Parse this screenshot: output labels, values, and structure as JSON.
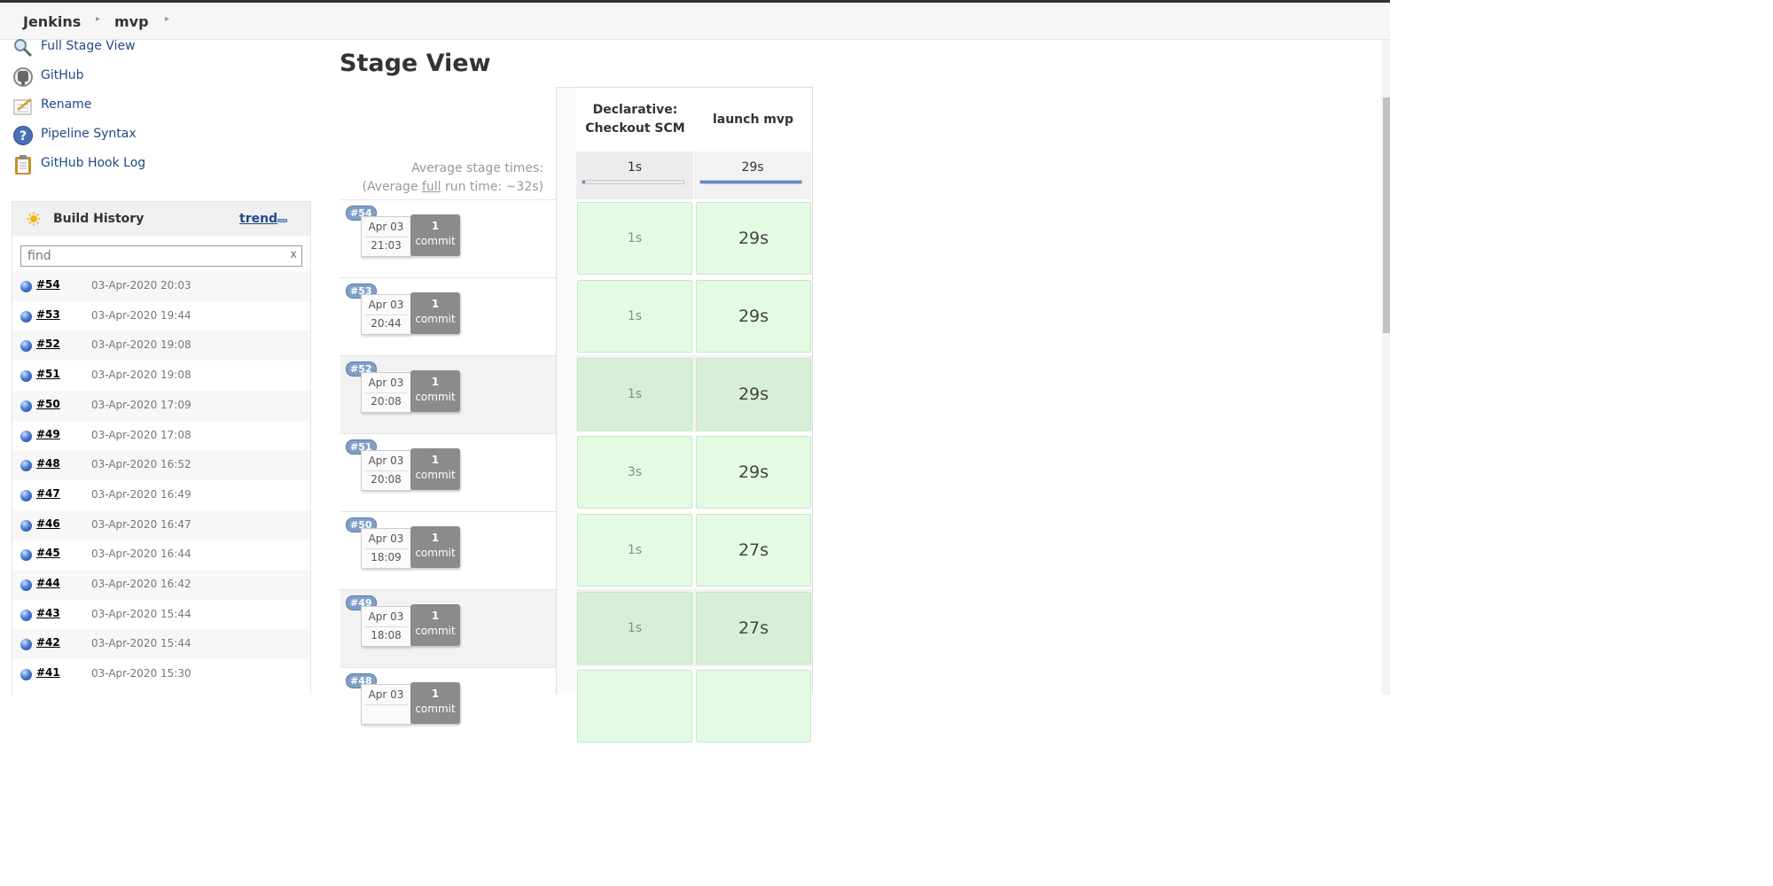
{
  "breadcrumb": {
    "items": [
      "Jenkins",
      "mvp"
    ]
  },
  "tasks": [
    {
      "label": "Full Stage View",
      "icon": "magnifier-icon"
    },
    {
      "label": "GitHub",
      "icon": "github-icon"
    },
    {
      "label": "Rename",
      "icon": "notepad-pencil-icon"
    },
    {
      "label": "Pipeline Syntax",
      "icon": "help-icon"
    },
    {
      "label": "GitHub Hook Log",
      "icon": "clipboard-icon"
    }
  ],
  "build_history": {
    "title": "Build History",
    "trend_label": "trend",
    "search_placeholder": "find",
    "clear_label": "x",
    "builds": [
      {
        "num": "#54",
        "date": "03-Apr-2020 20:03"
      },
      {
        "num": "#53",
        "date": "03-Apr-2020 19:44"
      },
      {
        "num": "#52",
        "date": "03-Apr-2020 19:08"
      },
      {
        "num": "#51",
        "date": "03-Apr-2020 19:08"
      },
      {
        "num": "#50",
        "date": "03-Apr-2020 17:09"
      },
      {
        "num": "#49",
        "date": "03-Apr-2020 17:08"
      },
      {
        "num": "#48",
        "date": "03-Apr-2020 16:52"
      },
      {
        "num": "#47",
        "date": "03-Apr-2020 16:49"
      },
      {
        "num": "#46",
        "date": "03-Apr-2020 16:47"
      },
      {
        "num": "#45",
        "date": "03-Apr-2020 16:44"
      },
      {
        "num": "#44",
        "date": "03-Apr-2020 16:42"
      },
      {
        "num": "#43",
        "date": "03-Apr-2020 15:44"
      },
      {
        "num": "#42",
        "date": "03-Apr-2020 15:44"
      },
      {
        "num": "#41",
        "date": "03-Apr-2020 15:30"
      }
    ]
  },
  "stage_view": {
    "title": "Stage View",
    "avg_label_line1": "Average stage times:",
    "avg_label_pre": "(Average ",
    "avg_label_full": "full",
    "avg_label_post": " run time: ~32s)",
    "stages": [
      {
        "name": "Declarative: Checkout SCM",
        "avg": "1s",
        "avg_fraction": 0.03
      },
      {
        "name": "launch mvp",
        "avg": "29s",
        "avg_fraction": 1.0
      }
    ],
    "runs": [
      {
        "badge": "#54",
        "month": "Apr 03",
        "time": "21:03",
        "commits_count": "1",
        "commits_label": "commit",
        "durations": [
          "1s",
          "29s"
        ]
      },
      {
        "badge": "#53",
        "month": "Apr 03",
        "time": "20:44",
        "commits_count": "1",
        "commits_label": "commit",
        "durations": [
          "1s",
          "29s"
        ]
      },
      {
        "badge": "#52",
        "month": "Apr 03",
        "time": "20:08",
        "commits_count": "1",
        "commits_label": "commit",
        "durations": [
          "1s",
          "29s"
        ]
      },
      {
        "badge": "#51",
        "month": "Apr 03",
        "time": "20:08",
        "commits_count": "1",
        "commits_label": "commit",
        "durations": [
          "3s",
          "29s"
        ]
      },
      {
        "badge": "#50",
        "month": "Apr 03",
        "time": "18:09",
        "commits_count": "1",
        "commits_label": "commit",
        "durations": [
          "1s",
          "27s"
        ]
      },
      {
        "badge": "#49",
        "month": "Apr 03",
        "time": "18:08",
        "commits_count": "1",
        "commits_label": "commit",
        "durations": [
          "1s",
          "27s"
        ]
      },
      {
        "badge": "#48",
        "month": "Apr 03",
        "time": "",
        "commits_count": "1",
        "commits_label": "commit",
        "durations": [
          "",
          ""
        ]
      }
    ]
  },
  "colors": {
    "link": "#204a87",
    "success_cell": "#e3fbe3",
    "badge": "#7f9fc8",
    "progress": "#5c8ad4"
  }
}
